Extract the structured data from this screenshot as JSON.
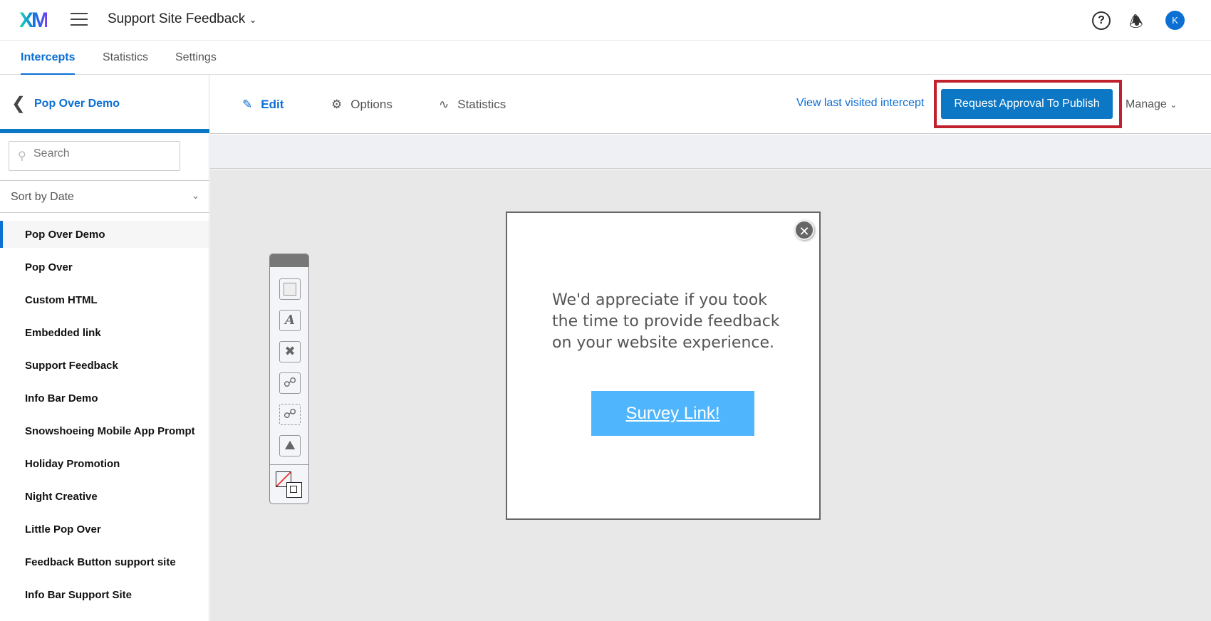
{
  "header": {
    "logo": "XM",
    "project": "Support Site Feedback",
    "avatar": "K"
  },
  "tabs": [
    {
      "label": "Intercepts"
    },
    {
      "label": "Statistics"
    },
    {
      "label": "Settings"
    }
  ],
  "sidebar": {
    "back_title": "Pop Over Demo",
    "search_placeholder": "Search",
    "sort_label": "Sort by Date",
    "items": [
      {
        "label": "Pop Over Demo"
      },
      {
        "label": "Pop Over"
      },
      {
        "label": "Custom HTML"
      },
      {
        "label": "Embedded link"
      },
      {
        "label": "Support Feedback"
      },
      {
        "label": "Info Bar Demo"
      },
      {
        "label": "Snowshoeing Mobile App Prompt"
      },
      {
        "label": "Holiday Promotion"
      },
      {
        "label": "Night Creative"
      },
      {
        "label": "Little Pop Over"
      },
      {
        "label": "Feedback Button support site"
      },
      {
        "label": "Info Bar Support Site"
      }
    ]
  },
  "toolbar": {
    "edit": "Edit",
    "options": "Options",
    "statistics": "Statistics",
    "view_last": "View last visited intercept",
    "request": "Request Approval To Publish",
    "manage": "Manage"
  },
  "popup": {
    "message": "We'd appreciate if you took the time to provide feedback on your website experience.",
    "button": "Survey Link!"
  },
  "colors": {
    "accent": "#0b77c5",
    "highlight": "#c0212f",
    "survey_button": "#4fb6fd"
  }
}
